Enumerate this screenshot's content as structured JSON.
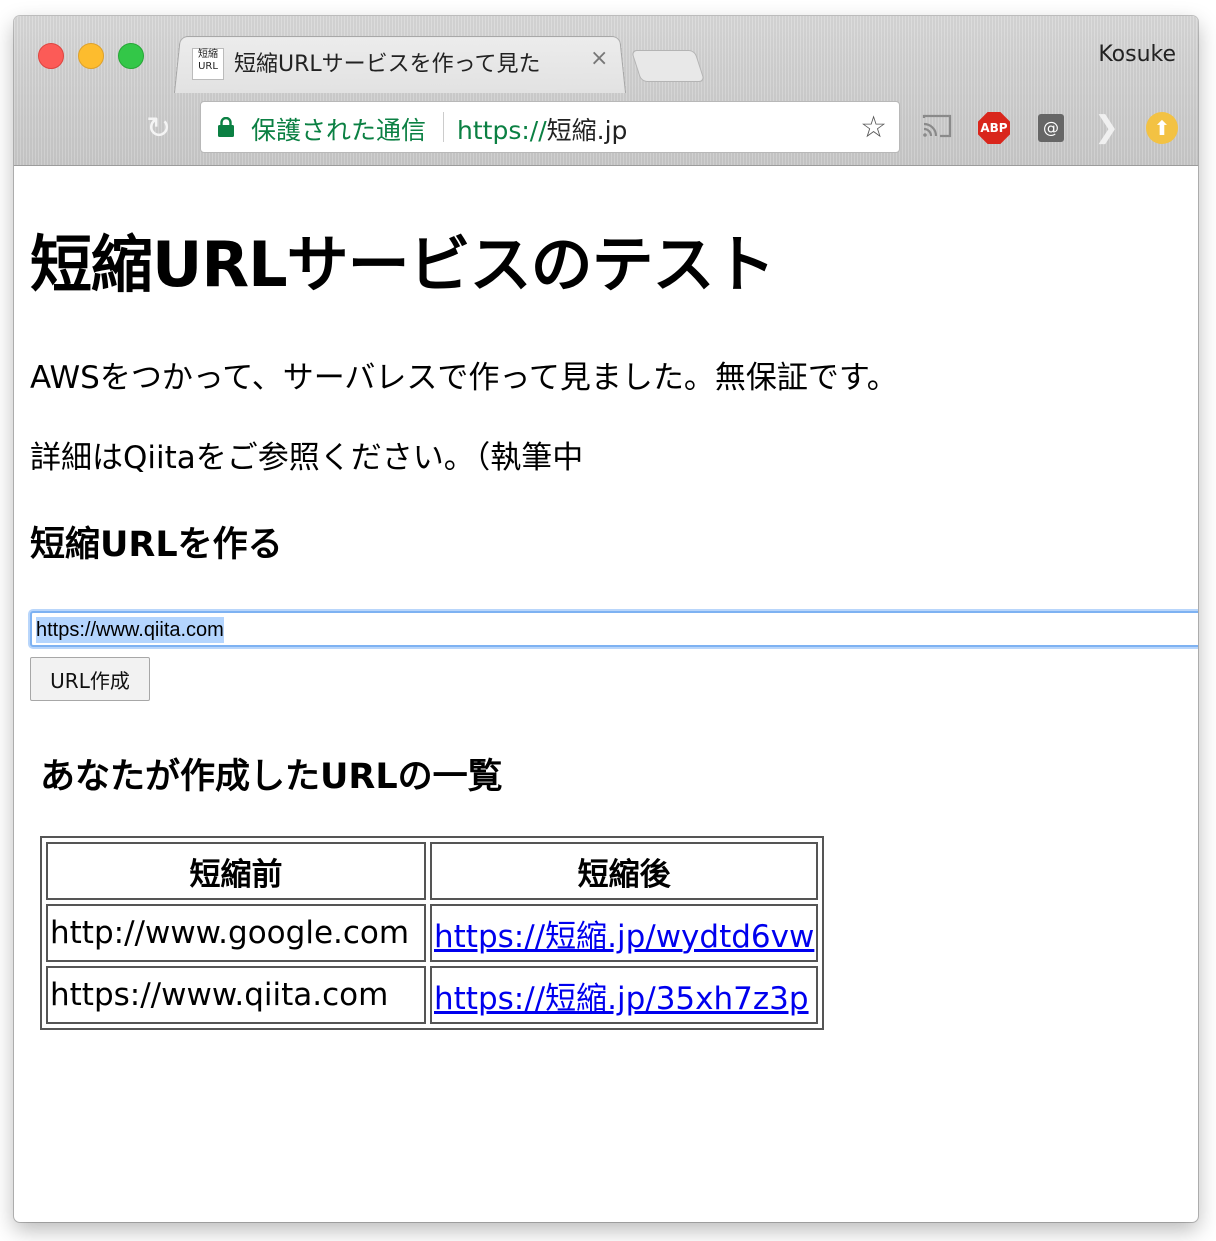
{
  "browser": {
    "tab_favicon_line1": "短縮",
    "tab_favicon_line2": "URL",
    "tab_title": "短縮URLサービスを作って見た",
    "tab_close": "×",
    "profile_name": "Kosuke",
    "secure_label": "保護された通信",
    "url_scheme": "https://",
    "url_host": "短縮.jp",
    "extensions": [
      "cast-icon",
      "adblock-plus-icon",
      "mail-at-icon",
      "arrow-extension-icon",
      "upload-extension-icon"
    ],
    "abp_label": "ABP",
    "at_label": "@"
  },
  "page": {
    "title": "短縮URLサービスのテスト",
    "intro": "AWSをつかって、サーバレスで作って見ました。無保証です。",
    "details": "詳細はQiitaをご参照ください。（執筆中",
    "create_heading": "短縮URLを作る",
    "input_value": "https://www.qiita.com",
    "create_button": "URL作成",
    "list_heading": "あなたが作成したURLの一覧",
    "table": {
      "headers": [
        "短縮前",
        "短縮後"
      ],
      "rows": [
        {
          "original": "http://www.google.com",
          "short": "https://短縮.jp/wydtd6vw"
        },
        {
          "original": "https://www.qiita.com",
          "short": "https://短縮.jp/35xh7z3p"
        }
      ]
    }
  },
  "colors": {
    "secure_green": "#0b8043",
    "link": "#0000ee",
    "focus_ring": "#7eb2f2"
  }
}
